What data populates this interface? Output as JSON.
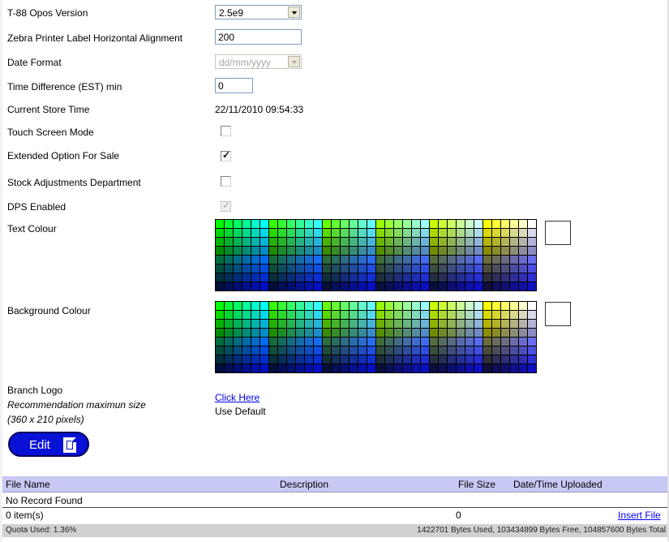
{
  "settings": {
    "opos_version": {
      "label": "T-88 Opos Version",
      "value": "2.5e9"
    },
    "zebra_alignment": {
      "label": "Zebra Printer Label Horizontal Alignment",
      "value": "200"
    },
    "date_format": {
      "label": "Date Format",
      "value": "dd/mm/yyyy"
    },
    "time_difference": {
      "label": "Time Difference (EST) min",
      "value": "0"
    },
    "store_time": {
      "label": "Current Store Time",
      "value": "22/11/2010 09:54:33"
    },
    "touch_screen": {
      "label": "Touch Screen Mode",
      "checked": false
    },
    "extended_option": {
      "label": "Extended Option For Sale",
      "checked": true
    },
    "stock_adjustments": {
      "label": "Stock Adjustments Department",
      "checked": false
    },
    "dps_enabled": {
      "label": "DPS Enabled",
      "checked": true,
      "disabled": true
    },
    "text_colour": {
      "label": "Text Colour",
      "selected": "#ffffff"
    },
    "background_colour": {
      "label": "Background Colour",
      "selected": "#ffffff"
    }
  },
  "branch_logo": {
    "label": "Branch Logo",
    "recommendation": "Recommendation maximun size",
    "size_hint": "(360 x 210 pixels)",
    "link": "Click Here",
    "default_text": "Use Default",
    "edit_label": "Edit",
    "edit_icon": "document-icon"
  },
  "files_table": {
    "headers": {
      "file_name": "File Name",
      "description": "Description",
      "file_size": "File Size",
      "uploaded": "Date/Time Uploaded"
    },
    "empty_message": "No Record Found",
    "item_count": "0 item(s)",
    "total_size": "0",
    "insert_link": "Insert File",
    "quota_used": "Quota Used: 1.36%",
    "quota_summary": "1422701 Bytes Used, 103434899 Bytes Free, 104857600 Bytes Total"
  },
  "colors": {
    "header_bg": "#c8c8f5",
    "edit_button": "#0a11d6",
    "link": "#0000ee"
  }
}
